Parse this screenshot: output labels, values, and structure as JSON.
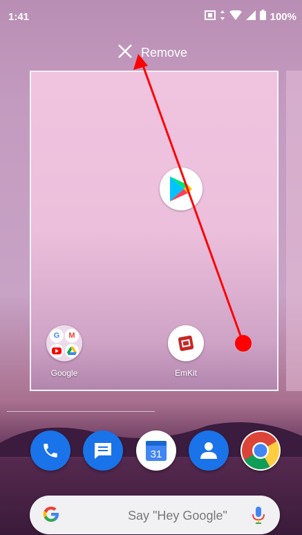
{
  "status_bar": {
    "time": "1:41",
    "battery": "100%"
  },
  "remove_target": {
    "label": "Remove"
  },
  "workspace": {
    "apps": [
      {
        "label": "Google"
      },
      {
        "label": "EmKit"
      }
    ]
  },
  "search": {
    "placeholder": "Say \"Hey Google\""
  },
  "colors": {
    "accent_red": "#ff0000",
    "google_blue": "#4285f4",
    "dock_blue": "#1a73e8"
  },
  "icons": [
    "close-icon",
    "play-store-icon",
    "phone-icon",
    "messages-icon",
    "calendar-icon",
    "contacts-icon",
    "chrome-icon",
    "google-g-icon",
    "mic-icon"
  ],
  "dock": {
    "calendar_day": "31"
  }
}
